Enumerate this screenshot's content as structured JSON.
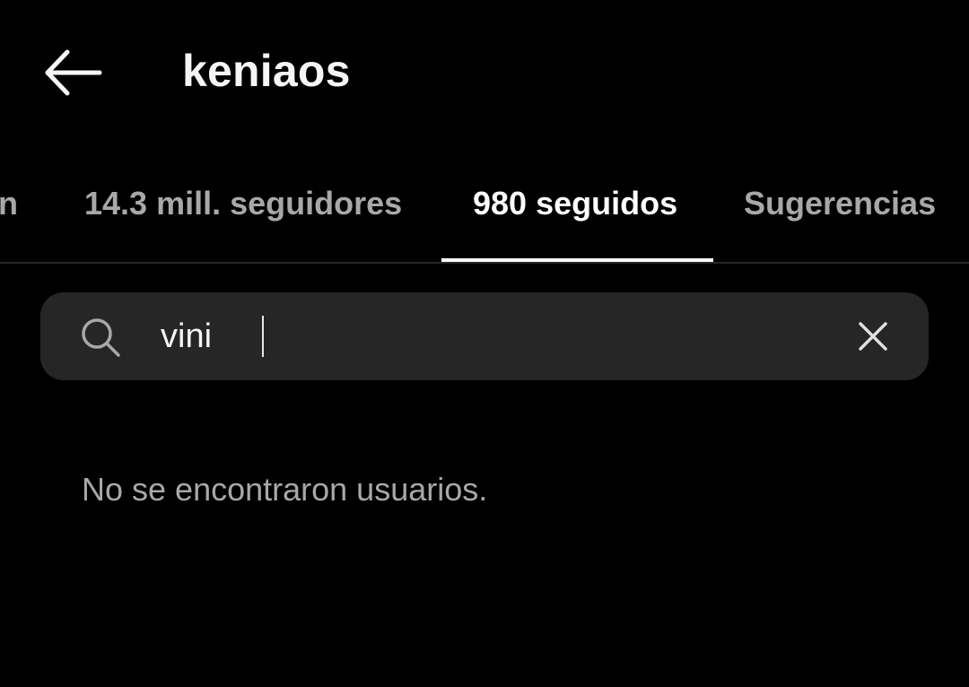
{
  "header": {
    "title": "keniaos",
    "back_icon": "arrow-left-icon"
  },
  "tabs": [
    {
      "label": "n",
      "active": false
    },
    {
      "label": "14.3 mill. seguidores",
      "active": false
    },
    {
      "label": "980 seguidos",
      "active": true
    },
    {
      "label": "Sugerencias",
      "active": false
    }
  ],
  "search": {
    "value": "vini",
    "icon": "search-icon",
    "clear_icon": "close-icon"
  },
  "results": {
    "empty_message": "No se encontraron usuarios."
  },
  "colors": {
    "background": "#000000",
    "active_text": "#ffffff",
    "inactive_text": "#a8a8a8",
    "search_bg": "#262626"
  }
}
